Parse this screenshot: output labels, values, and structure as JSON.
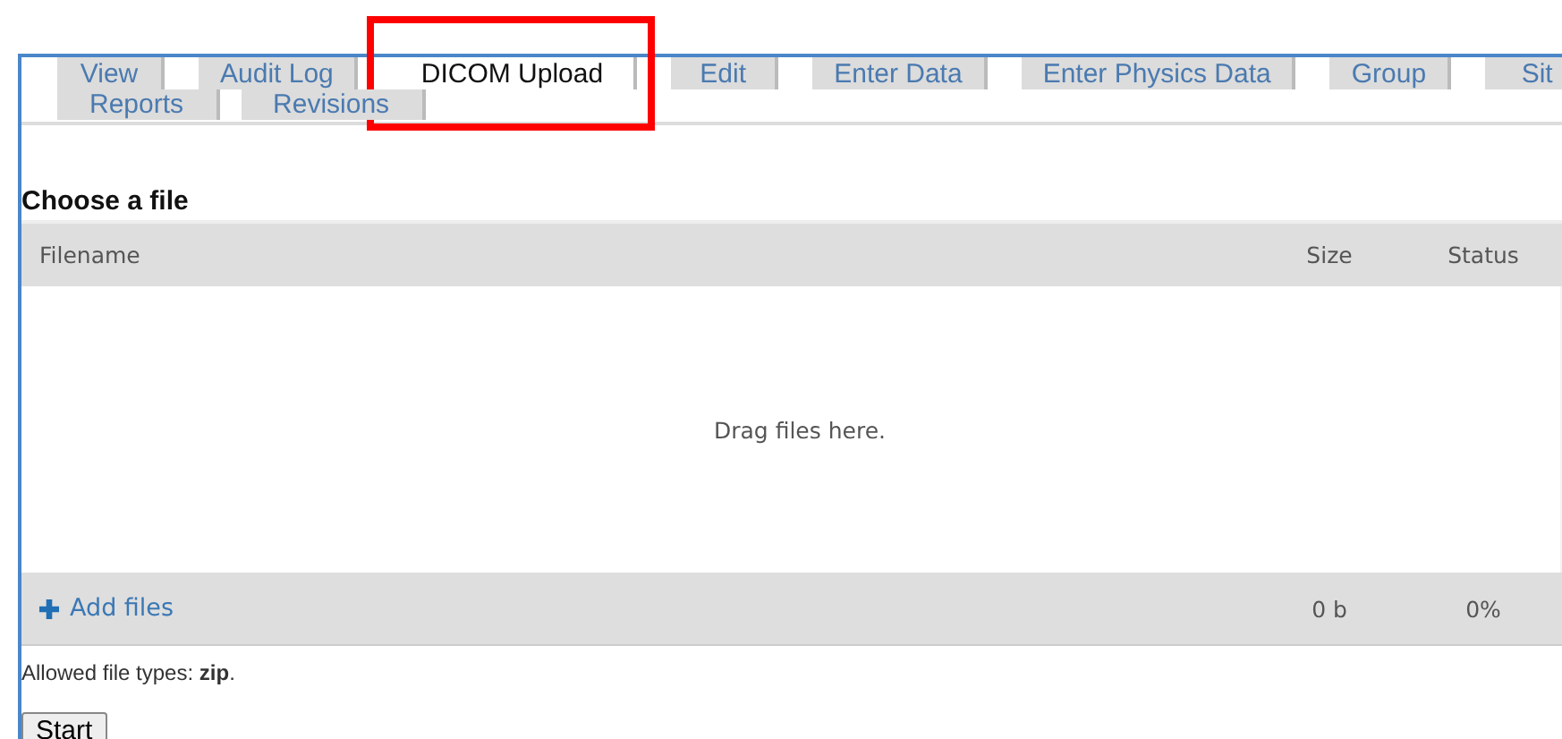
{
  "tabs_row_1": [
    {
      "label": "View",
      "selected": false
    },
    {
      "label": "Audit Log",
      "selected": false
    },
    {
      "label": "DICOM Upload",
      "selected": true
    },
    {
      "label": "Edit",
      "selected": false
    },
    {
      "label": "Enter Data",
      "selected": false
    },
    {
      "label": "Enter Physics Data",
      "selected": false
    },
    {
      "label": "Group",
      "selected": false
    },
    {
      "label": "Sit",
      "selected": false
    }
  ],
  "tabs_row_2": [
    {
      "label": "Reports",
      "selected": false
    },
    {
      "label": "Revisions",
      "selected": false
    }
  ],
  "annotation": {
    "kind": "box-around-selected-tab"
  },
  "heading": "Choose a file",
  "uploader": {
    "columns": [
      "Filename",
      "Size",
      "Status"
    ],
    "empty_message": "Drag files here.",
    "add_button": "Add files",
    "total_size": "0 b",
    "total_status": "0%"
  },
  "allowed_types": "Allowed file types: **zip**.",
  "start_button": "Start"
}
